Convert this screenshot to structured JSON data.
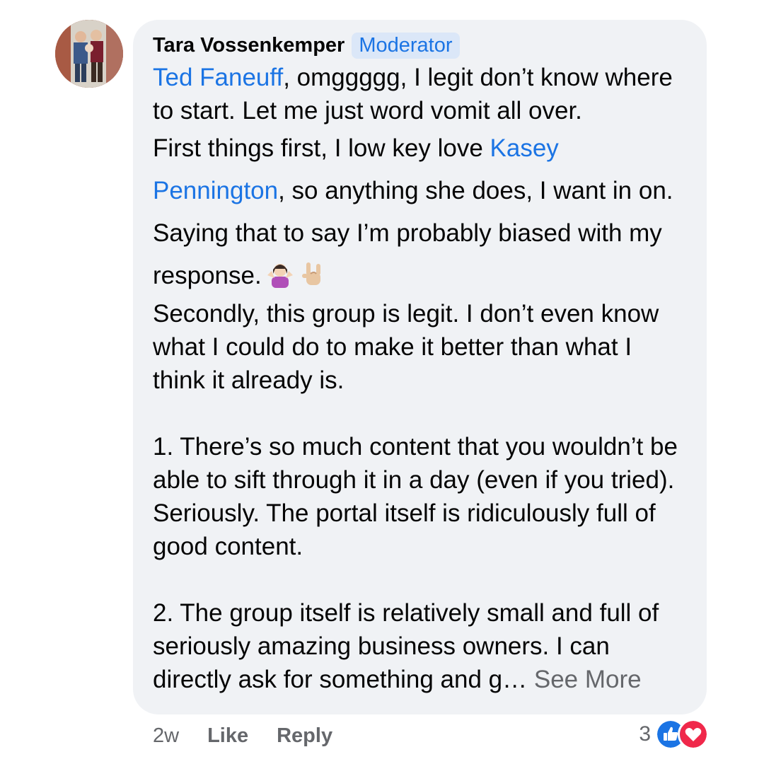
{
  "comment": {
    "author": "Tara Vossenkemper",
    "role": "Moderator",
    "mention1": "Ted Faneuff",
    "line_intro": ", omggggg, I legit don’t know where to start. Let me just word vomit all over.",
    "line_first_pre": "First things first, I low key love ",
    "mention2": "Kasey Pennington",
    "line_first_post": ", so anything she does, I want in on. Saying that to say I’m probably biased with my response.",
    "line_second": "Secondly, this group is legit. I don’t even know what I could do to make it better than what I think it already is.",
    "point1": "1. There’s so much content that you wouldn’t be able to sift through it in a day (even if you tried). Seriously. The portal itself is ridiculously full of good content.",
    "point2": "2. The group itself is relatively small and full of seriously amazing business owners. I can directly ask for something and g… ",
    "see_more": "See More",
    "emoji1": "person-shrugging-emoji",
    "emoji2": "sign-of-the-horns-emoji"
  },
  "actions": {
    "time": "2w",
    "like": "Like",
    "reply": "Reply"
  },
  "reactions": {
    "count": "3",
    "icons": [
      "like-reaction-icon",
      "love-reaction-icon"
    ]
  },
  "colors": {
    "bubble": "#f0f2f5",
    "link": "#1b74e4",
    "secondary_text": "#65676b",
    "like_blue": "#1b74e4",
    "love_red": "#f0284a"
  }
}
